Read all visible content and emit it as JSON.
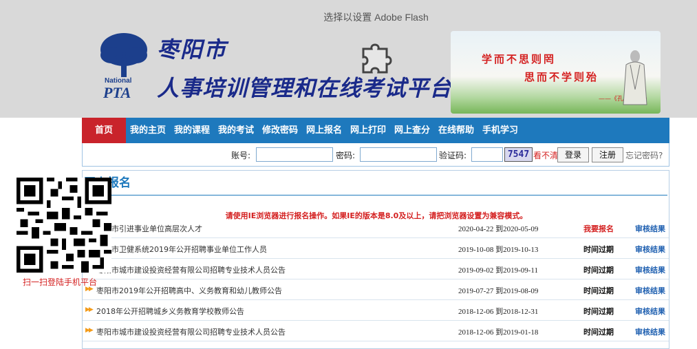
{
  "flash": {
    "prompt": "选择以设置 Adobe Flash"
  },
  "brand": {
    "logo_text_top": "National",
    "logo_text_bottom": "PTA",
    "city": "枣阳市",
    "title": "人事培训管理和在线考试平台",
    "motto_line1": "学而不思则罔",
    "motto_line2": "思而不学则殆",
    "motto_source": "——《孔子·论语》"
  },
  "nav": {
    "items": [
      "首页",
      "我的主页",
      "我的课程",
      "我的考试",
      "修改密码",
      "网上报名",
      "网上打印",
      "网上查分",
      "在线帮助",
      "手机学习"
    ]
  },
  "login": {
    "account_label": "账号:",
    "password_label": "密码:",
    "captcha_label": "验证码:",
    "captcha_value": "7547",
    "cant_see": "看不清",
    "login_button": "登录",
    "register_button": "注册",
    "forgot": "忘记密码?"
  },
  "section": {
    "title": "网上报名",
    "notice": "请使用IE浏览器进行报名操作。如果IE的版本是8.0及以上，请把浏览器设置为兼容模式。"
  },
  "rows": [
    {
      "title": "枣阳市引进事业单位高层次人才",
      "dates": "2020-04-22 到2020-05-09",
      "status": "我要报名",
      "result": "审核结果"
    },
    {
      "title": "枣阳市卫健系统2019年公开招聘事业单位工作人员",
      "dates": "2019-10-08 到2019-10-13",
      "status": "时间过期",
      "result": "审核结果"
    },
    {
      "title": "枣阳市城市建设投资经营有限公司招聘专业技术人员公告",
      "dates": "2019-09-02 到2019-09-11",
      "status": "时间过期",
      "result": "审核结果"
    },
    {
      "title": "枣阳市2019年公开招聘高中、义务教育和幼儿教师公告",
      "dates": "2019-07-27 到2019-08-09",
      "status": "时间过期",
      "result": "审核结果"
    },
    {
      "title": "2018年公开招聘城乡义务教育学校教师公告",
      "dates": "2018-12-06 到2018-12-31",
      "status": "时间过期",
      "result": "审核结果"
    },
    {
      "title": "枣阳市城市建设投资经营有限公司招聘专业技术人员公告",
      "dates": "2018-12-06 到2019-01-18",
      "status": "时间过期",
      "result": "审核结果"
    }
  ],
  "qr": {
    "caption": "扫一扫登陆手机平台"
  },
  "colors": {
    "nav_blue": "#1e79bd",
    "home_red": "#c9232b",
    "alert_red": "#d42020",
    "link_blue": "#1e5fb0"
  }
}
